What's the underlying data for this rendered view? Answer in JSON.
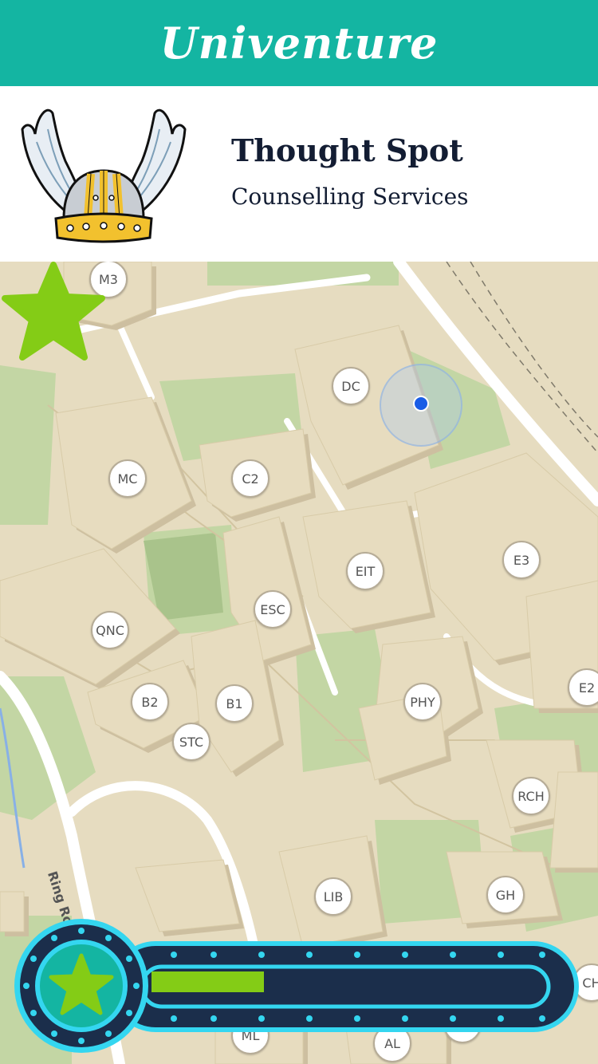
{
  "app": {
    "title": "Univenture"
  },
  "place": {
    "name": "Thought Spot",
    "category": "Counselling Services"
  },
  "map": {
    "buildings": [
      {
        "code": "M3"
      },
      {
        "code": "DC"
      },
      {
        "code": "MC"
      },
      {
        "code": "C2"
      },
      {
        "code": "EIT"
      },
      {
        "code": "E3"
      },
      {
        "code": "ESC"
      },
      {
        "code": "QNC"
      },
      {
        "code": "B2"
      },
      {
        "code": "B1"
      },
      {
        "code": "PHY"
      },
      {
        "code": "E2"
      },
      {
        "code": "STC"
      },
      {
        "code": "RCH"
      },
      {
        "code": "LIB"
      },
      {
        "code": "GH"
      },
      {
        "code": "ML"
      },
      {
        "code": "AL"
      },
      {
        "code": "TC"
      },
      {
        "code": "CH"
      }
    ],
    "road_label": "Ring Road"
  },
  "icons": {
    "logo": "viking-helmet-logo-icon",
    "marker": "star-marker-icon",
    "badge": "star-badge-icon"
  },
  "colors": {
    "accent": "#14b5a2",
    "star": "#84cc16",
    "navy": "#1b2e4b",
    "cyan": "#34d6f0",
    "location": "#1a5de6"
  },
  "progress": {
    "fraction": 0.29
  }
}
